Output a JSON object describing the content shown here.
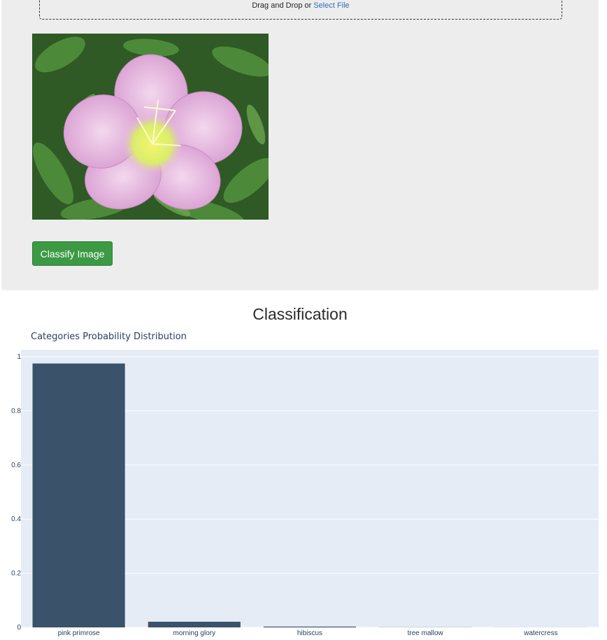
{
  "upload": {
    "prompt": "Drag and Drop or",
    "link": "Select File"
  },
  "preview": {
    "subject": "pink evening primrose flower photo"
  },
  "actions": {
    "classify_label": "Classify Image"
  },
  "results": {
    "heading": "Classification"
  },
  "colors": {
    "button": "#3c9a45",
    "bar": "#3a536b",
    "plot_bg": "#e5ecf6",
    "link": "#2f6fb3"
  },
  "chart_data": {
    "type": "bar",
    "title": "Categories Probability Distribution",
    "categories": [
      "pink primrose",
      "morning glory",
      "hibiscus",
      "tree mallow",
      "watercress"
    ],
    "values": [
      0.975,
      0.021,
      0.003,
      0.0005,
      0.0002
    ],
    "ylim": [
      0,
      1
    ],
    "yticks": [
      0,
      0.2,
      0.4,
      0.6,
      0.8,
      1
    ],
    "ytick_labels": [
      "0",
      "0.2",
      "0.4",
      "0.6",
      "0.8",
      "1"
    ],
    "grid": true,
    "legend": false
  }
}
